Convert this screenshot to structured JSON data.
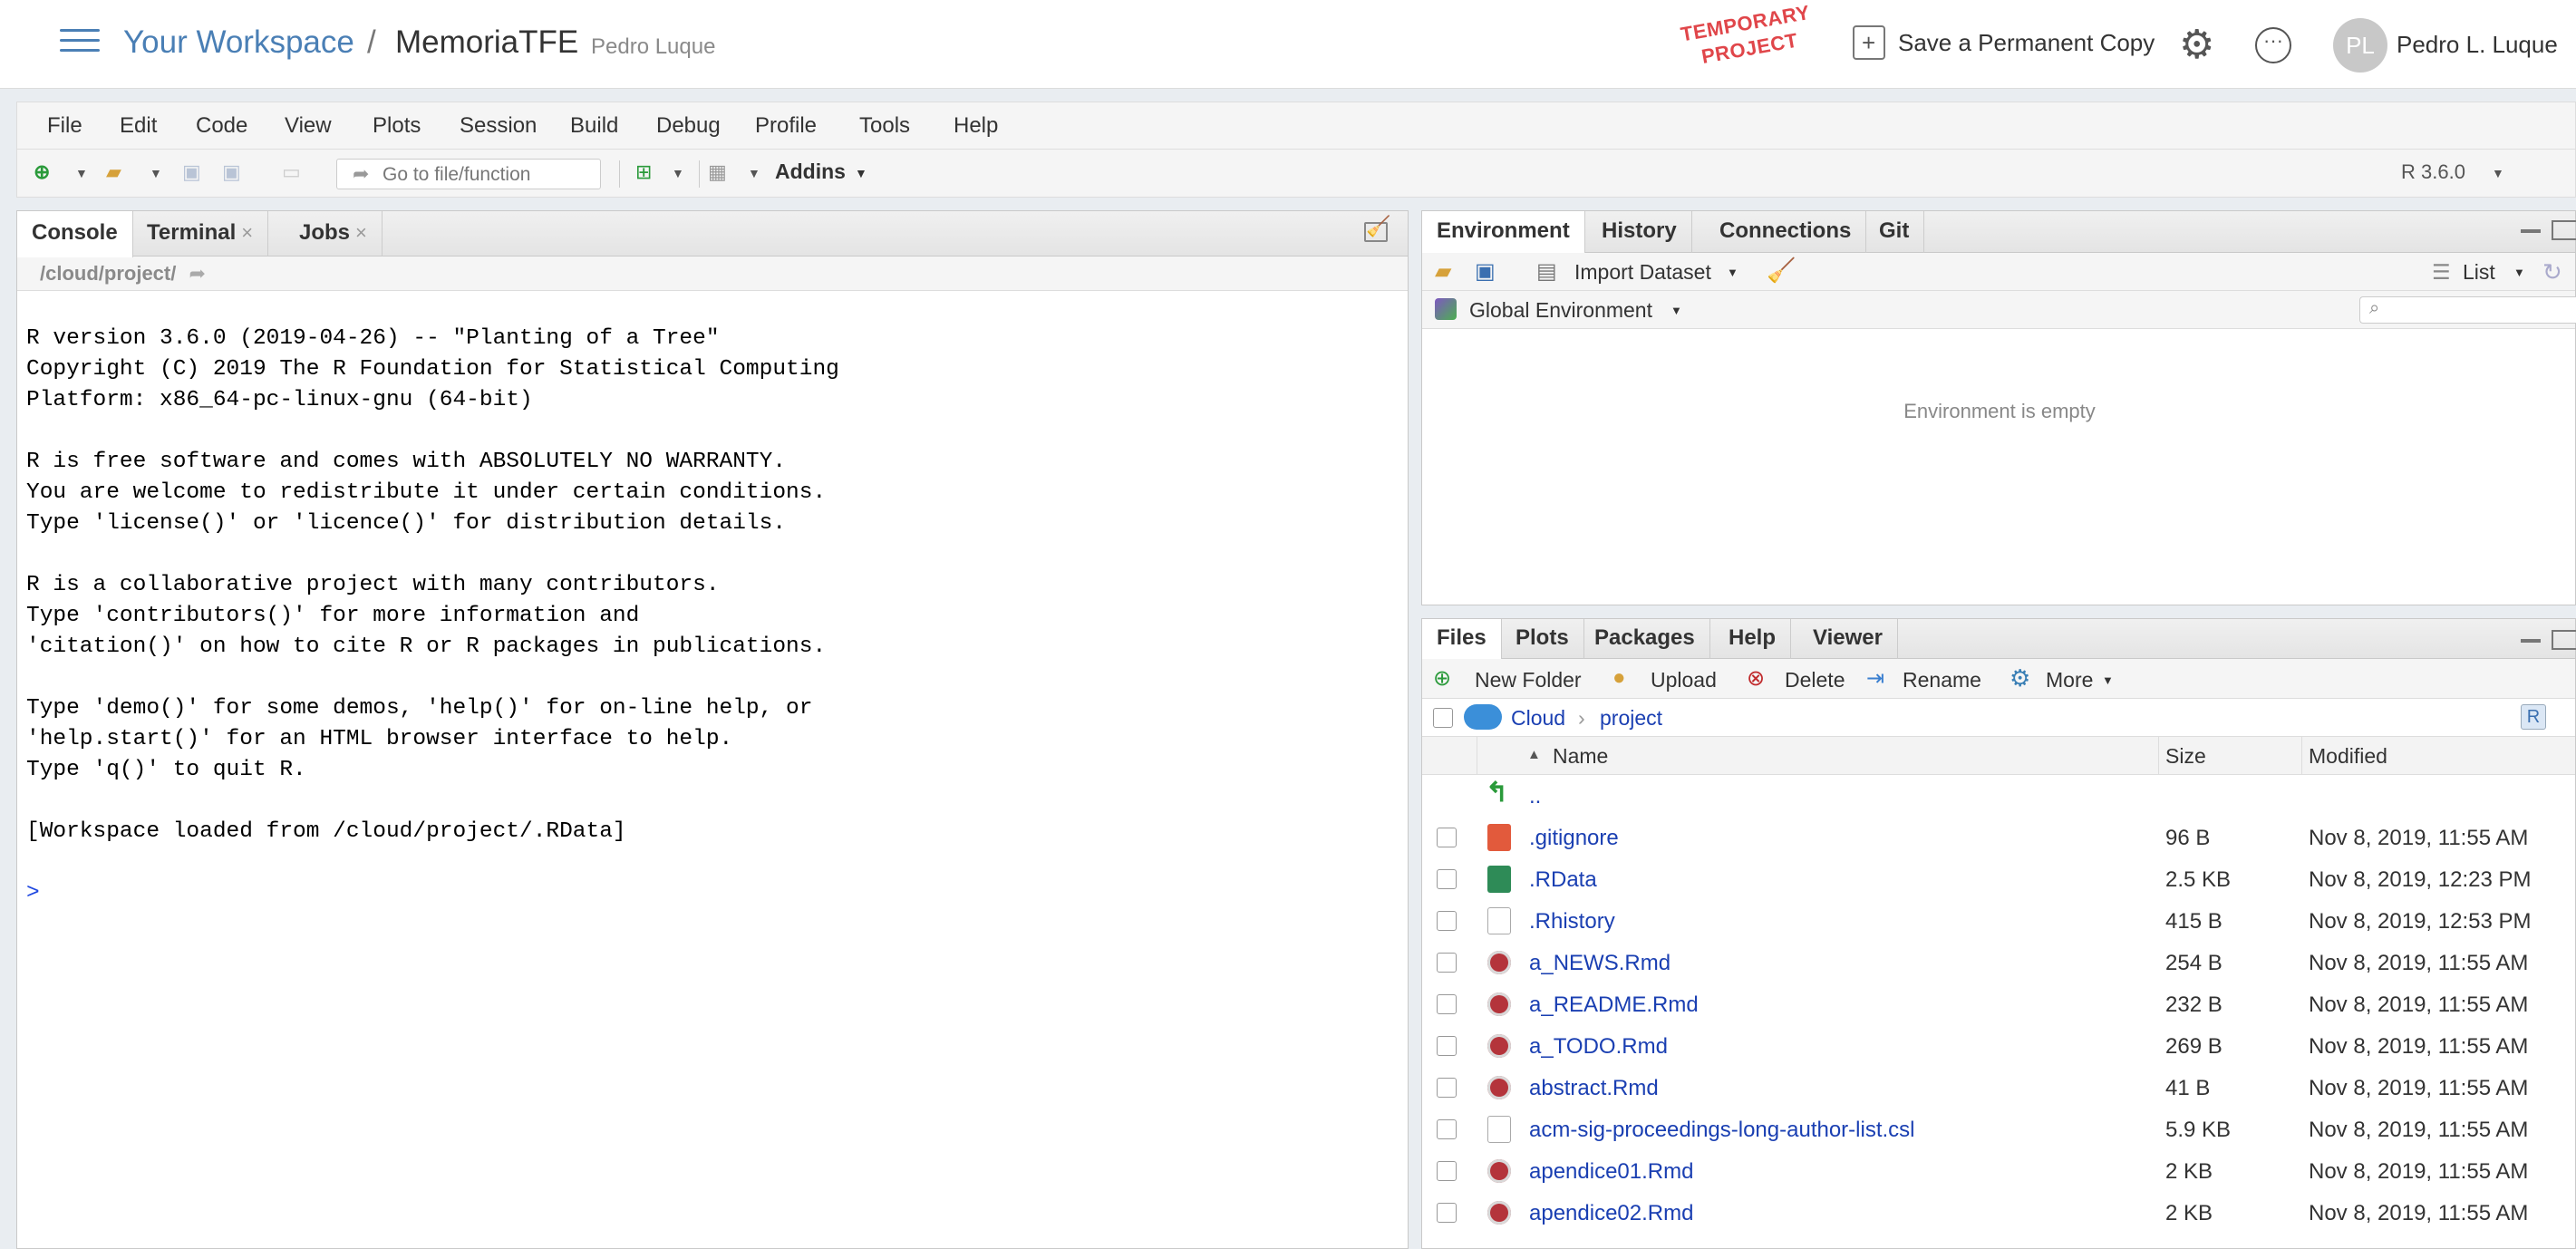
{
  "header": {
    "workspace": "Your Workspace",
    "separator": "/",
    "project": "MemoriaTFE",
    "owner": "Pedro Luque",
    "temporary_line1": "TEMPORARY",
    "temporary_line2": "PROJECT",
    "save_copy": "Save a Permanent Copy",
    "avatar_initials": "PL",
    "user_name": "Pedro L. Luque"
  },
  "menu": [
    "File",
    "Edit",
    "Code",
    "View",
    "Plots",
    "Session",
    "Build",
    "Debug",
    "Profile",
    "Tools",
    "Help"
  ],
  "toolbar": {
    "goto_placeholder": "Go to file/function",
    "addins": "Addins",
    "r_version": "R 3.6.0"
  },
  "console_pane": {
    "tabs": [
      "Console",
      "Terminal",
      "Jobs"
    ],
    "path": "/cloud/project/",
    "lines": [
      "R version 3.6.0 (2019-04-26) -- \"Planting of a Tree\"",
      "Copyright (C) 2019 The R Foundation for Statistical Computing",
      "Platform: x86_64-pc-linux-gnu (64-bit)",
      "",
      "R is free software and comes with ABSOLUTELY NO WARRANTY.",
      "You are welcome to redistribute it under certain conditions.",
      "Type 'license()' or 'licence()' for distribution details.",
      "",
      "R is a collaborative project with many contributors.",
      "Type 'contributors()' for more information and",
      "'citation()' on how to cite R or R packages in publications.",
      "",
      "Type 'demo()' for some demos, 'help()' for on-line help, or",
      "'help.start()' for an HTML browser interface to help.",
      "Type 'q()' to quit R.",
      "",
      "[Workspace loaded from /cloud/project/.RData]",
      ""
    ],
    "prompt": ">"
  },
  "env_pane": {
    "tabs": [
      "Environment",
      "History",
      "Connections",
      "Git"
    ],
    "import_dataset": "Import Dataset",
    "view_mode": "List",
    "scope": "Global Environment",
    "empty_message": "Environment is empty"
  },
  "files_pane": {
    "tabs": [
      "Files",
      "Plots",
      "Packages",
      "Help",
      "Viewer"
    ],
    "actions": {
      "new_folder": "New Folder",
      "upload": "Upload",
      "delete": "Delete",
      "rename": "Rename",
      "more": "More"
    },
    "breadcrumb": [
      "Cloud",
      "project"
    ],
    "columns": {
      "name": "Name",
      "size": "Size",
      "modified": "Modified"
    },
    "parent": "..",
    "files": [
      {
        "name": ".gitignore",
        "size": "96 B",
        "modified": "Nov 8, 2019, 11:55 AM",
        "icon": "git-icon"
      },
      {
        "name": ".RData",
        "size": "2.5 KB",
        "modified": "Nov 8, 2019, 12:23 PM",
        "icon": "rdata-icon"
      },
      {
        "name": ".Rhistory",
        "size": "415 B",
        "modified": "Nov 8, 2019, 12:53 PM",
        "icon": "history-icon"
      },
      {
        "name": "a_NEWS.Rmd",
        "size": "254 B",
        "modified": "Nov 8, 2019, 11:55 AM",
        "icon": "rmd-icon"
      },
      {
        "name": "a_README.Rmd",
        "size": "232 B",
        "modified": "Nov 8, 2019, 11:55 AM",
        "icon": "rmd-icon"
      },
      {
        "name": "a_TODO.Rmd",
        "size": "269 B",
        "modified": "Nov 8, 2019, 11:55 AM",
        "icon": "rmd-icon"
      },
      {
        "name": "abstract.Rmd",
        "size": "41 B",
        "modified": "Nov 8, 2019, 11:55 AM",
        "icon": "rmd-icon"
      },
      {
        "name": "acm-sig-proceedings-long-author-list.csl",
        "size": "5.9 KB",
        "modified": "Nov 8, 2019, 11:55 AM",
        "icon": "file-icon"
      },
      {
        "name": "apendice01.Rmd",
        "size": "2 KB",
        "modified": "Nov 8, 2019, 11:55 AM",
        "icon": "rmd-icon"
      },
      {
        "name": "apendice02.Rmd",
        "size": "2 KB",
        "modified": "Nov 8, 2019, 11:55 AM",
        "icon": "rmd-icon"
      }
    ]
  }
}
